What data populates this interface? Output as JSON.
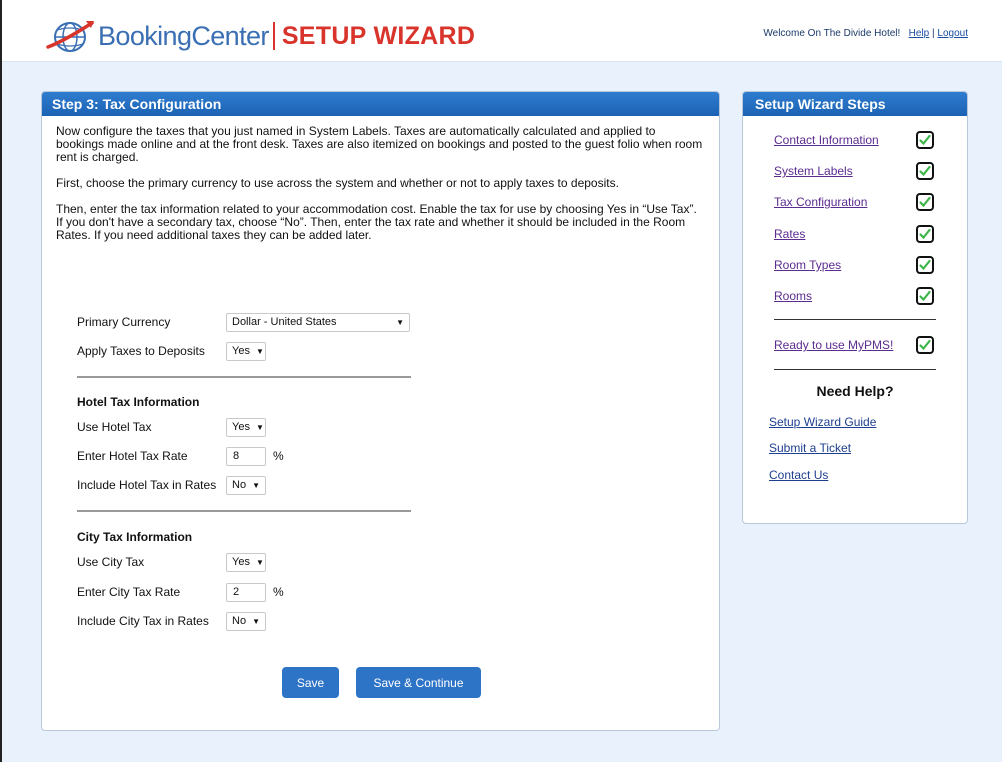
{
  "header": {
    "brand": "BookingCenter",
    "title": "SETUP WIZARD",
    "welcome": "Welcome  On The Divide Hotel!",
    "help_link": "Help",
    "separator": "|",
    "logout_link": "Logout"
  },
  "main": {
    "heading": "Step 3: Tax Configuration",
    "intro": [
      "Now configure the taxes that you just named in System Labels. Taxes are automatically calculated and applied to bookings made online and at the front desk. Taxes are also itemized on bookings and posted to the guest folio when room rent is charged.",
      "First, choose the primary currency to use across the system and whether or not to apply taxes to deposits.",
      "Then, enter the tax information related to your accommodation cost. Enable the tax for use by choosing Yes in “Use Tax”. If you don't have a secondary tax, choose “No”. Then, enter the tax rate and whether it should be included in the Room Rates. If you need additional taxes they can be added later."
    ],
    "primary_currency": {
      "label": "Primary Currency",
      "value": "Dollar - United States"
    },
    "apply_taxes_deposits": {
      "label": "Apply Taxes to Deposits",
      "value": "Yes"
    },
    "hotel_tax": {
      "title": "Hotel Tax Information",
      "use_label": "Use Hotel Tax",
      "use_value": "Yes",
      "rate_label": "Enter Hotel Tax Rate",
      "rate_value": "8",
      "rate_unit": "%",
      "include_label": "Include Hotel Tax in Rates",
      "include_value": "No"
    },
    "city_tax": {
      "title": "City Tax Information",
      "use_label": "Use City Tax",
      "use_value": "Yes",
      "rate_label": "Enter City Tax Rate",
      "rate_value": "2",
      "rate_unit": "%",
      "include_label": "Include City Tax in Rates",
      "include_value": "No"
    },
    "save_label": "Save",
    "save_continue_label": "Save & Continue"
  },
  "sidebar": {
    "heading": "Setup Wizard Steps",
    "steps": [
      {
        "label": "Contact Information",
        "done": true
      },
      {
        "label": "System Labels",
        "done": true
      },
      {
        "label": "Tax Configuration",
        "done": true
      },
      {
        "label": "Rates",
        "done": true
      },
      {
        "label": "Room Types",
        "done": true
      },
      {
        "label": "Rooms",
        "done": true
      }
    ],
    "ready": {
      "label": "Ready to use MyPMS!",
      "done": true
    },
    "need_help": "Need Help?",
    "help_links": [
      "Setup Wizard Guide",
      "Submit a Ticket",
      "Contact Us"
    ]
  },
  "colors": {
    "accent": "#2e74c6",
    "brand_red": "#d8342b",
    "brand_blue": "#3a6fb3",
    "check_green": "#3db54a"
  },
  "icons": {
    "logo": "globe-swoosh-icon",
    "check": "check-icon",
    "dropdown": "caret-down-icon"
  }
}
